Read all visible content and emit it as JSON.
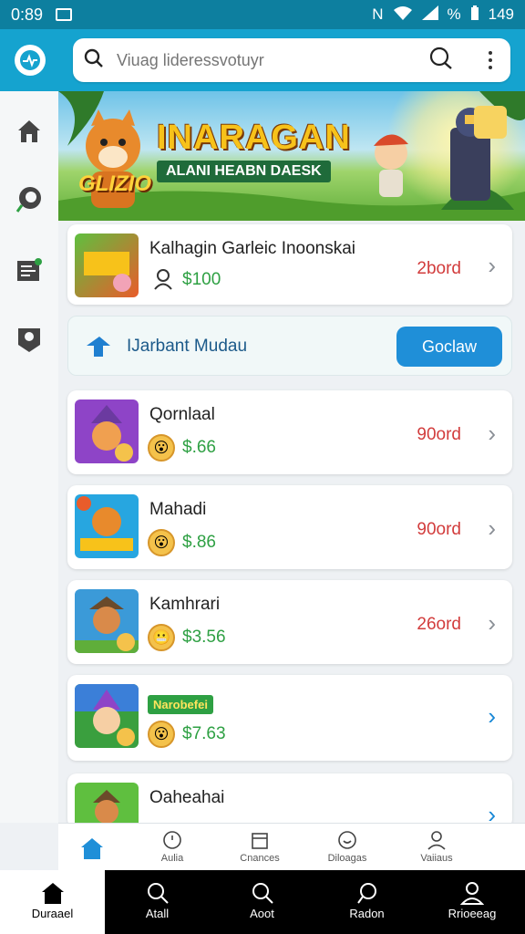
{
  "status_bar": {
    "time": "0:89",
    "battery": "149"
  },
  "search": {
    "placeholder": "Viuag lideressvotuyr"
  },
  "banner": {
    "title": "INARAGAN",
    "subtitle": "ALANI HEABN DAESK",
    "badge": "GLIZIO"
  },
  "featured": {
    "title": "Kalhagin Garleic Inoonskai",
    "price": "$100",
    "rank": "2bord"
  },
  "promo": {
    "label": "IJarbant Mudau",
    "button": "Goclaw"
  },
  "items": [
    {
      "title": "Qornlaal",
      "price": "$.66",
      "rank": "90ord",
      "thumb_color": "#8e44c7"
    },
    {
      "title": "Mahadi",
      "price": "$.86",
      "rank": "90ord",
      "thumb_color": "#27a6e0"
    },
    {
      "title": "Kamhrari",
      "price": "$3.56",
      "rank": "26ord",
      "thumb_color": "#3b9ad8"
    },
    {
      "title": "",
      "tag": "Narobefei",
      "price": "$7.63",
      "rank": "",
      "thumb_color": "#3a9f3e"
    },
    {
      "title": "Oaheahai",
      "price": "",
      "rank": "",
      "thumb_color": "#5fbf3f"
    }
  ],
  "subnav": [
    "Aulia",
    "Cnances",
    "Diloagas",
    "Vaiiaus"
  ],
  "bottom_nav": [
    "Duraael",
    "Atall",
    "Aoot",
    "Radon",
    "Rrioeeag"
  ],
  "colors": {
    "accent": "#15a3cf",
    "price": "#2ea043",
    "rank": "#d23c3c",
    "button": "#1f8fd8"
  }
}
